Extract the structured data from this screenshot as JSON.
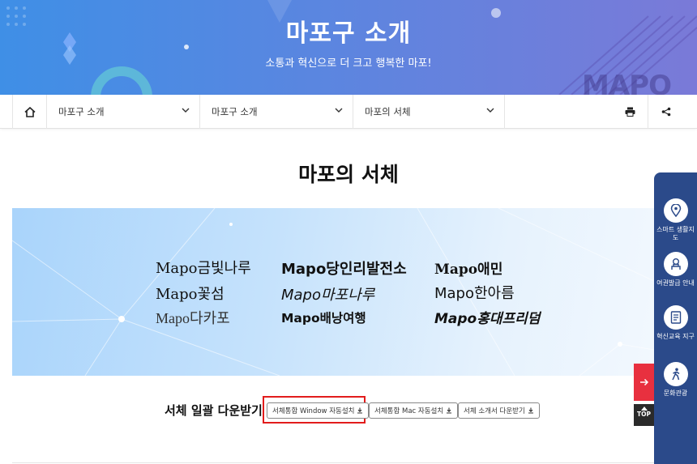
{
  "hero": {
    "title": "마포구 소개",
    "subtitle": "소통과 혁신으로 더 크고 행복한 마포!",
    "logo_text": "MAPO"
  },
  "breadcrumb": {
    "home_icon": "home-icon",
    "items": [
      {
        "label": "마포구 소개"
      },
      {
        "label": "마포구 소개"
      },
      {
        "label": "마포의 서체"
      }
    ],
    "tools": [
      "print-icon",
      "share-icon"
    ]
  },
  "page": {
    "title": "마포의 서체"
  },
  "fonts": [
    {
      "name": "Mapo금빛나루"
    },
    {
      "name": "Mapo당인리발전소"
    },
    {
      "name": "Mapo애민"
    },
    {
      "name": "Mapo꽃섬"
    },
    {
      "name": "Mapo마포나루"
    },
    {
      "name": "Mapo한아름"
    },
    {
      "name": "Mapo다카포"
    },
    {
      "name": "Mapo배낭여행"
    },
    {
      "name": "Mapo홍대프리덤"
    }
  ],
  "download": {
    "label": "서체 일괄 다운받기",
    "buttons": [
      {
        "label": "서체통합 Window 자동설치"
      },
      {
        "label": "서체통합 Mac 자동설치"
      },
      {
        "label": "서체 소개서 다운받기"
      }
    ]
  },
  "quick_menu": {
    "items": [
      {
        "label": "스마트 생활지도",
        "icon": "map-pin-icon"
      },
      {
        "label": "여권발급 안내",
        "icon": "passport-icon"
      },
      {
        "label": "혁신교육 지구",
        "icon": "book-icon"
      },
      {
        "label": "문화관광",
        "icon": "walker-icon"
      }
    ],
    "top_label": "TOP"
  },
  "colors": {
    "hero_start": "#3f8fe6",
    "hero_end": "#7a7ad8",
    "quick_menu_bg": "#2b4a8a",
    "highlight": "#e21c1c",
    "arrow_bg": "#e8303f"
  }
}
